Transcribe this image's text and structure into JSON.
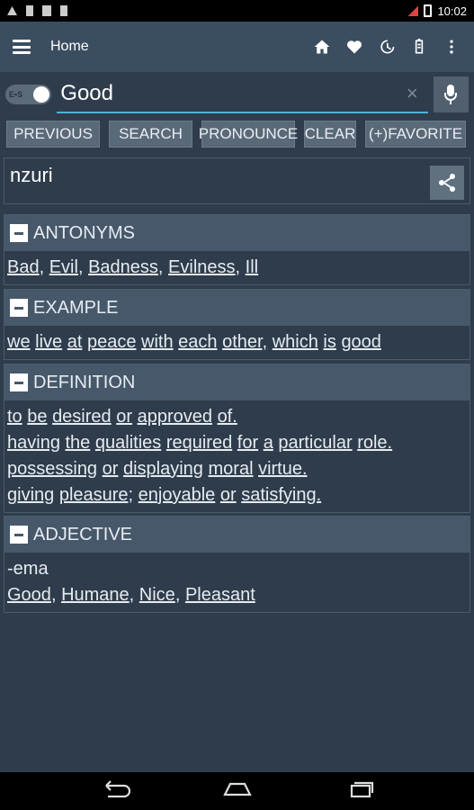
{
  "status_bar": {
    "time": "10:02"
  },
  "app_bar": {
    "title": "Home"
  },
  "search": {
    "toggle_label": "E•S",
    "value": "Good",
    "clear": "×"
  },
  "buttons": {
    "previous": "PREVIOUS",
    "search": "SEARCH",
    "pronounce": "PRONOUNCE",
    "clear": "CLEAR",
    "favorite": "(+)FAVORITE"
  },
  "result": {
    "word": "nzuri"
  },
  "antonyms": {
    "title": "ANTONYMS",
    "items": [
      "Bad",
      "Evil",
      "Badness",
      "Evilness",
      "Ill"
    ]
  },
  "example": {
    "title": "EXAMPLE",
    "words": [
      "we",
      "live",
      "at",
      "peace",
      "with",
      "each",
      "other,",
      "which",
      "is",
      "good"
    ]
  },
  "definition": {
    "title": "DEFINITION",
    "lines": [
      [
        "to",
        "be",
        "desired",
        "or",
        "approved",
        "of."
      ],
      [
        "having",
        "the",
        "qualities",
        "required",
        "for",
        "a",
        "particular",
        "role."
      ],
      [
        "possessing",
        "or",
        "displaying",
        "moral",
        "virtue."
      ],
      [
        "giving",
        "pleasure;",
        "enjoyable",
        "or",
        "satisfying."
      ]
    ]
  },
  "adjective": {
    "title": "ADJECTIVE",
    "word": "-ema",
    "items": [
      "Good",
      "Humane",
      "Nice",
      "Pleasant"
    ]
  }
}
